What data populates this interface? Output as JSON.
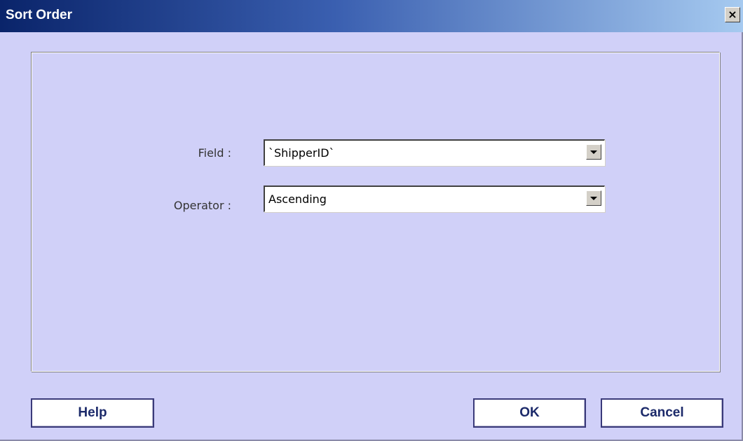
{
  "window": {
    "title": "Sort Order",
    "close_glyph": "×",
    "close_icon": "close-icon"
  },
  "form": {
    "field_label": "Field :",
    "field_value": "`ShipperID`",
    "operator_label": "Operator :",
    "operator_value": "Ascending",
    "dropdown_icon": "chevron-down-icon"
  },
  "buttons": {
    "help": "Help",
    "ok": "OK",
    "cancel": "Cancel"
  },
  "colors": {
    "background": "#d0d0f8",
    "titlebar_start": "#0a246a",
    "titlebar_end": "#a6caf0",
    "button_text": "#1c2a6a"
  }
}
